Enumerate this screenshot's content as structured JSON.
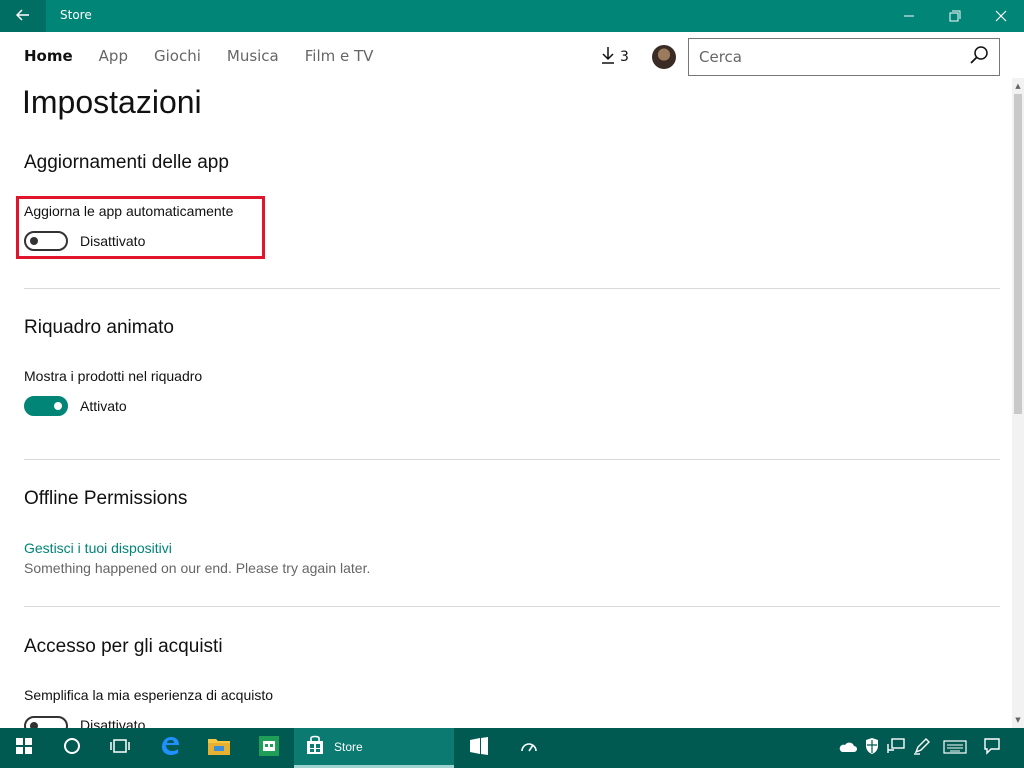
{
  "window": {
    "title": "Store",
    "back_icon": "back-arrow-icon",
    "minimize_icon": "minimize-icon",
    "maximize_icon": "restore-icon",
    "close_icon": "close-icon"
  },
  "nav": {
    "tabs": [
      {
        "label": "Home",
        "active": true
      },
      {
        "label": "App",
        "active": false
      },
      {
        "label": "Giochi",
        "active": false
      },
      {
        "label": "Musica",
        "active": false
      },
      {
        "label": "Film e TV",
        "active": false
      }
    ],
    "downloads_count": "3",
    "download_icon": "download-icon"
  },
  "search": {
    "placeholder": "Cerca",
    "icon": "search-icon"
  },
  "page": {
    "title": "Impostazioni"
  },
  "sections": {
    "updates": {
      "title": "Aggiornamenti delle app",
      "setting_label": "Aggiorna le app automaticamente",
      "toggle_state": "Disattivato",
      "toggle_on": false
    },
    "live_tile": {
      "title": "Riquadro animato",
      "setting_label": "Mostra i prodotti nel riquadro",
      "toggle_state": "Attivato",
      "toggle_on": true
    },
    "offline": {
      "title": "Offline Permissions",
      "link": "Gestisci i tuoi dispositivi",
      "error": "Something happened on our end. Please try again later."
    },
    "purchase": {
      "title": "Accesso per gli acquisti",
      "setting_label": "Semplifica la mia esperienza di acquisto",
      "toggle_state": "Disattivato",
      "toggle_on": false
    }
  },
  "taskbar": {
    "active_app_label": "Store",
    "icons": [
      "windows-start-icon",
      "cortana-icon",
      "task-view-icon",
      "edge-icon",
      "file-explorer-icon",
      "store-app-icon",
      "store-icon",
      "tablet-icon",
      "speedometer-icon"
    ],
    "tray_icons": [
      "onedrive-icon",
      "security-icon",
      "network-icon",
      "pen-icon",
      "keyboard-icon",
      "notifications-icon"
    ]
  },
  "colors": {
    "accent": "#008577",
    "titlebar": "#008577",
    "taskbar": "#005a52",
    "highlight": "#e0142b",
    "link": "#008577"
  }
}
